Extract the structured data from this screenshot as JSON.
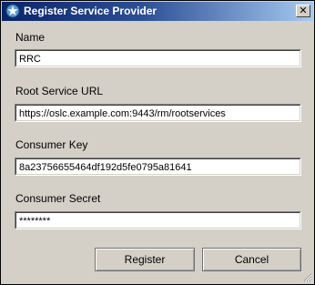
{
  "window": {
    "title": "Register Service Provider",
    "close_glyph": "✕",
    "icon": "gear-star-icon"
  },
  "fields": {
    "name": {
      "label": "Name",
      "value": "RRC"
    },
    "root_url": {
      "label": "Root Service URL",
      "value": "https://oslc.example.com:9443/rm/rootservices"
    },
    "consumer_key": {
      "label": "Consumer Key",
      "value": "8a23756655464df192d5fe0795a81641"
    },
    "consumer_secret": {
      "label": "Consumer Secret",
      "value": "********"
    }
  },
  "buttons": {
    "register": "Register",
    "cancel": "Cancel"
  },
  "colors": {
    "titlebar_start": "#0a246a",
    "titlebar_end": "#a6caf0",
    "dialog_bg": "#d4d0c8"
  }
}
